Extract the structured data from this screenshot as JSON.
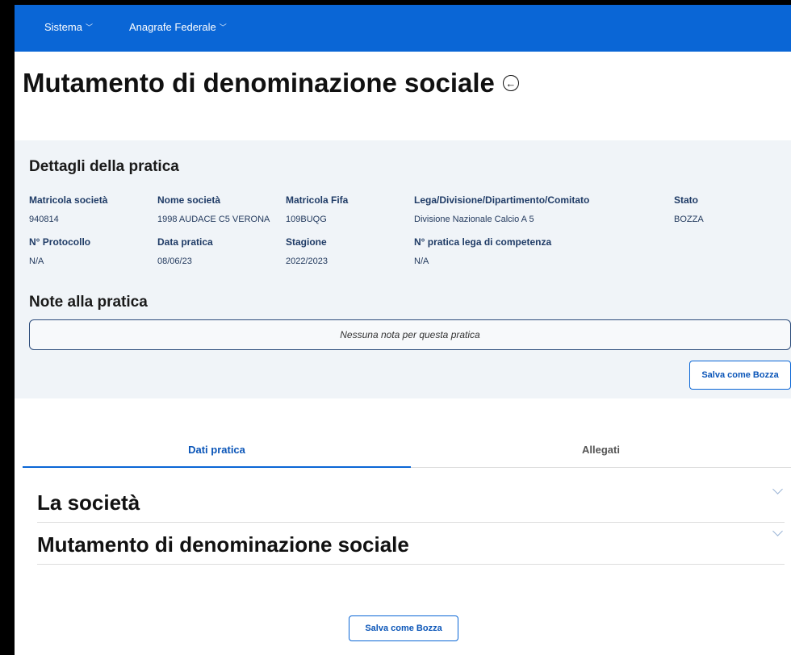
{
  "nav": {
    "items": [
      {
        "label": "Sistema"
      },
      {
        "label": "Anagrafe Federale"
      }
    ]
  },
  "page": {
    "title": "Mutamento di denominazione sociale"
  },
  "details": {
    "heading": "Dettagli della pratica",
    "fields": [
      {
        "label": "Matricola società",
        "value": "940814"
      },
      {
        "label": "Nome società",
        "value": "1998 AUDACE C5 VERONA"
      },
      {
        "label": "Matricola Fifa",
        "value": "109BUQG"
      },
      {
        "label": "Lega/Divisione/Dipartimento/Comitato",
        "value": "Divisione Nazionale Calcio A 5"
      },
      {
        "label": "Stato",
        "value": "BOZZA"
      },
      {
        "label": "N° Protocollo",
        "value": "N/A"
      },
      {
        "label": "Data pratica",
        "value": "08/06/23"
      },
      {
        "label": "Stagione",
        "value": "2022/2023"
      },
      {
        "label": "N° pratica lega di competenza",
        "value": "N/A"
      }
    ]
  },
  "notes": {
    "heading": "Note alla pratica",
    "empty_text": "Nessuna nota per questa pratica",
    "save_label": "Salva come Bozza"
  },
  "tabs": [
    {
      "label": "Dati pratica",
      "active": true
    },
    {
      "label": "Allegati",
      "active": false
    }
  ],
  "sections": [
    {
      "title": "La società"
    },
    {
      "title": "Mutamento di denominazione sociale"
    }
  ],
  "footer": {
    "save_label": "Salva come Bozza"
  },
  "colors": {
    "nav": "#0a66d6",
    "panel": "#f0f4f8",
    "label": "#1f3b66",
    "accent": "#0a55b8"
  }
}
